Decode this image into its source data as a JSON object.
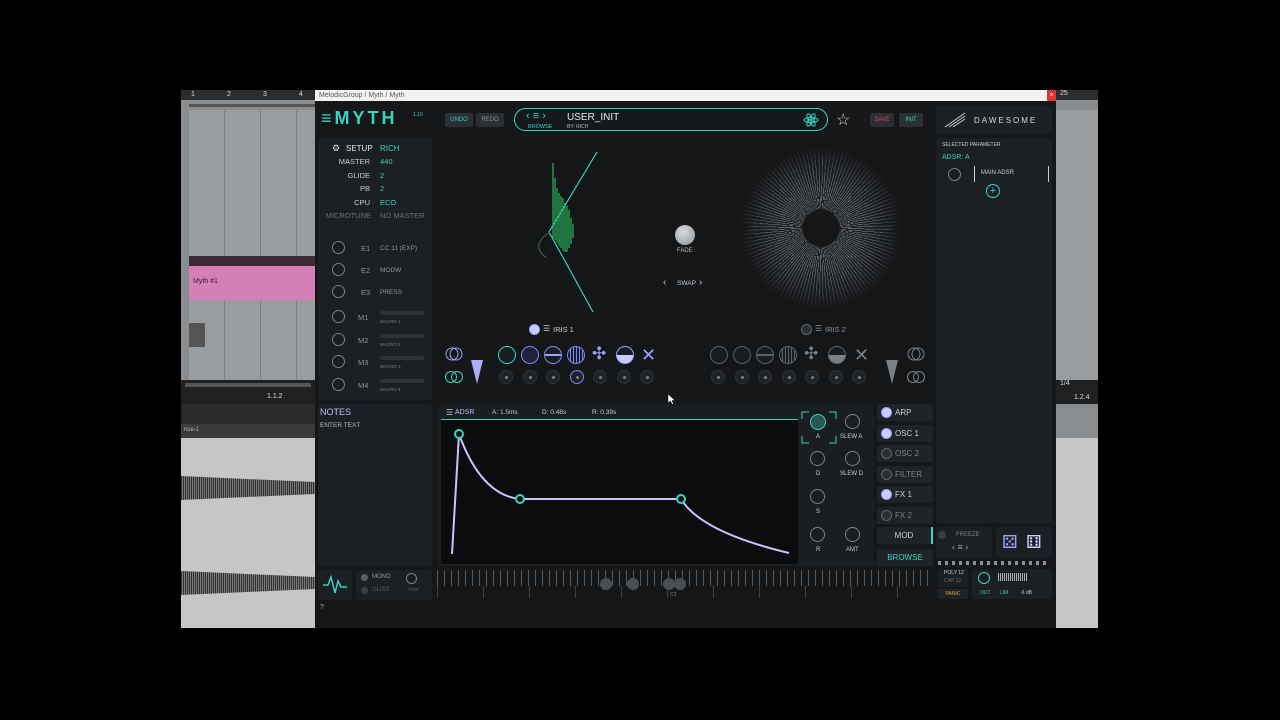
{
  "window": {
    "title": "MelodicGroup / Myth / Myth",
    "close": "×"
  },
  "daw": {
    "ruler_top": [
      "1",
      "2",
      "3",
      "4"
    ],
    "ruler_right": "25",
    "clip_name": "Myth #1",
    "pos_left": "1.1.2",
    "pos_right": "1.2.4",
    "track_label": "nce-1",
    "right_ctrl": "1/4"
  },
  "header": {
    "logo": "≡MYTH",
    "version": "1.10",
    "undo": "UNDO",
    "redo": "REDO",
    "browse_label": "BROWSE",
    "preset_name": "USER_INIT",
    "preset_author": "BY: RICH",
    "save": "SAVE",
    "init": "INIT",
    "brand": "DAWESOME",
    "star": "☆"
  },
  "setup": {
    "title": "SETUP",
    "user": "RICH",
    "rows": [
      {
        "k": "MASTER",
        "v": "440"
      },
      {
        "k": "GLIDE",
        "v": "2"
      },
      {
        "k": "PB",
        "v": "2"
      },
      {
        "k": "CPU",
        "v": "ECO"
      },
      {
        "k": "MICROTUNE",
        "v": "NO MASTER"
      }
    ],
    "expr": [
      {
        "k": "E1",
        "v": "CC 11 (EXP)"
      },
      {
        "k": "E2",
        "v": "MODW"
      },
      {
        "k": "E3",
        "v": "PRESS"
      }
    ],
    "macros": [
      {
        "k": "M1",
        "v": "MACRO 1"
      },
      {
        "k": "M2",
        "v": "MACRO 2"
      },
      {
        "k": "M3",
        "v": "MACRO 3"
      },
      {
        "k": "M4",
        "v": "MACRO 4"
      }
    ]
  },
  "notes": {
    "title": "NOTES",
    "placeholder": "ENTER TEXT"
  },
  "voice": {
    "mono": "MONO",
    "gliss": "GLISS",
    "time": "TIME"
  },
  "center": {
    "fade": "FADE",
    "swap": "SWAP",
    "iris1": "IRIS 1",
    "iris2": "IRIS 2"
  },
  "adsr": {
    "title": "ADSR",
    "a": "A:   1.5ms",
    "d": "D:   0.48s",
    "r": "R:   0.39s",
    "knobs": {
      "a": "A",
      "slew_a": "SLEW A",
      "d": "D",
      "slew_d": "SLEW D",
      "s": "S",
      "r": "R",
      "amt": "AMT"
    }
  },
  "side": {
    "items": [
      {
        "label": "ARP",
        "on": true
      },
      {
        "label": "OSC 1",
        "on": true
      },
      {
        "label": "OSC 2",
        "on": false
      },
      {
        "label": "FILTER",
        "on": false
      },
      {
        "label": "FX 1",
        "on": true
      },
      {
        "label": "FX 2",
        "on": false
      }
    ],
    "mod": "MOD",
    "browse": "BROWSE"
  },
  "right": {
    "selected_title": "SELECTED PARAMETER",
    "selected_value": "ADSR: A",
    "main_adsr": "MAIN ADSR",
    "freeze": "FREEZE",
    "poly": "POLY 12",
    "cap": "CAP 12",
    "panic": "PANIC",
    "out": "OUT",
    "lim": "LIM",
    "db": "-6 dB"
  },
  "keyboard": {
    "c3": "C3"
  },
  "footer": {
    "help": "?"
  },
  "colors": {
    "accent": "#36d3c0",
    "env": "#c8c3ff",
    "save": "#e04060",
    "clip": "#d47fb6"
  }
}
